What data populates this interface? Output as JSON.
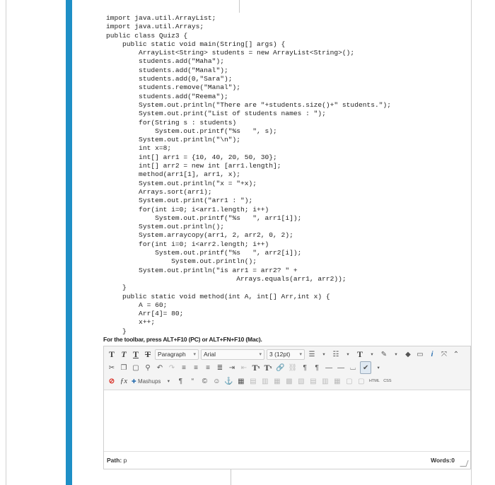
{
  "code_lines": [
    "import java.util.ArrayList;",
    "import java.util.Arrays;",
    "public class Quiz3 {",
    "    public static void main(String[] args) {",
    "        ArrayList<String> students = new ArrayList<String>();",
    "        students.add(\"Maha\");",
    "        students.add(\"Manal\");",
    "        students.add(0,\"Sara\");",
    "        students.remove(\"Manal\");",
    "        students.add(\"Reema\");",
    "        System.out.println(\"There are \"+students.size()+\" students.\");",
    "        System.out.print(\"List of students names : \");",
    "        for(String s : students)",
    "            System.out.printf(\"%s   \", s);",
    "        System.out.println(\"\\n\");",
    "        int x=8;",
    "        int[] arr1 = {10, 40, 20, 50, 30};",
    "        int[] arr2 = new int [arr1.length];",
    "        method(arr1[1], arr1, x);",
    "        System.out.println(\"x = \"+x);",
    "        Arrays.sort(arr1);",
    "        System.out.print(\"arr1 : \");",
    "        for(int i=0; i<arr1.length; i++)",
    "            System.out.printf(\"%s   \", arr1[i]);",
    "        System.out.println();",
    "        System.arraycopy(arr1, 2, arr2, 0, 2);",
    "        for(int i=0; i<arr2.length; i++)",
    "            System.out.printf(\"%s   \", arr2[i]);",
    "                System.out.println();",
    "        System.out.println(\"is arr1 = arr2? \" +",
    "                                Arrays.equals(arr1, arr2));",
    "    }",
    "    public static void method(int A, int[] Arr,int x) {",
    "        A = 60;",
    "        Arr[4]= 80;",
    "        x++;",
    "    }"
  ],
  "instruction": "For the toolbar, press ALT+F10 (PC) or ALT+FN+F10 (Mac).",
  "toolbar": {
    "format_t1": "T",
    "format_t2": "T",
    "format_t3": "T",
    "format_t4": "T",
    "paragraph_select": "Paragraph",
    "font_select": "Arial",
    "size_select": "3 (12pt)",
    "mashups_label": "Mashups",
    "html_label": "HTML",
    "css_label": "CSS",
    "superscript_label": "T",
    "subscript_label": "T",
    "font_color_label": "T"
  },
  "status": {
    "path_label": "Path:",
    "path_value": "p",
    "words_label": "Words:0"
  },
  "colors": {
    "accent_bar": "#1e8fc6",
    "error_red": "#d9342b",
    "link_orange": "#e07a1f"
  }
}
